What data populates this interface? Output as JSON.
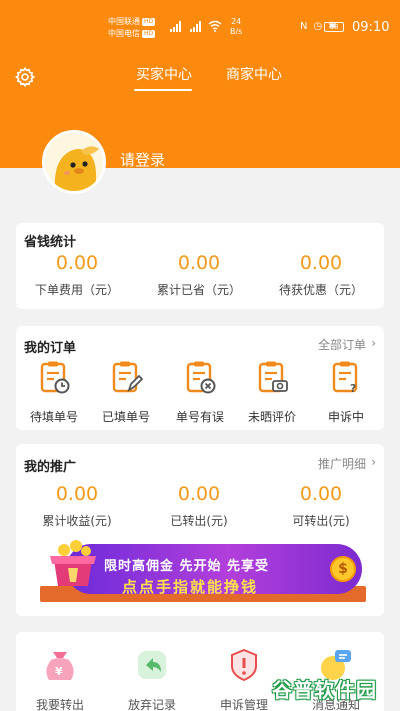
{
  "status_bar": {
    "carrier1": "中国联通",
    "carrier2": "中国电信",
    "badge": "HD",
    "net_speed_value": "24",
    "net_speed_unit": "B/s",
    "battery": "88",
    "time": "09:10"
  },
  "header": {
    "tabs": [
      {
        "label": "买家中心",
        "active": true
      },
      {
        "label": "商家中心",
        "active": false
      }
    ],
    "login_text": "请登录"
  },
  "savings": {
    "title": "省钱统计",
    "stats": [
      {
        "value": "0.00",
        "label": "下单费用（元）"
      },
      {
        "value": "0.00",
        "label": "累计已省（元）"
      },
      {
        "value": "0.00",
        "label": "待获优惠（元）"
      }
    ]
  },
  "orders": {
    "title": "我的订单",
    "link": "全部订单",
    "items": [
      {
        "label": "待填单号",
        "icon": "clock-clipboard-icon"
      },
      {
        "label": "已填单号",
        "icon": "edit-clipboard-icon"
      },
      {
        "label": "单号有误",
        "icon": "error-clipboard-icon"
      },
      {
        "label": "未晒评价",
        "icon": "camera-clipboard-icon"
      },
      {
        "label": "申诉中",
        "icon": "question-clipboard-icon"
      }
    ]
  },
  "promotion": {
    "title": "我的推广",
    "link": "推广明细",
    "stats": [
      {
        "value": "0.00",
        "label": "累计收益(元)"
      },
      {
        "value": "0.00",
        "label": "已转出(元)"
      },
      {
        "value": "0.00",
        "label": "可转出(元)"
      }
    ],
    "banner": {
      "line1": "限时高佣金 先开始 先享受",
      "line2": "点点手指就能挣钱",
      "coin_symbol": "$"
    }
  },
  "bottom_menu": {
    "items": [
      {
        "label": "我要转出",
        "icon": "money-bag-icon"
      },
      {
        "label": "放弃记录",
        "icon": "return-arrow-icon"
      },
      {
        "label": "申诉管理",
        "icon": "warning-shield-icon"
      },
      {
        "label": "消息通知",
        "icon": "chat-bubble-icon"
      }
    ]
  },
  "watermark": "谷普软件园",
  "colors": {
    "brand_orange": "#fb8a0e",
    "value_orange": "#f39a1a",
    "background": "#f2f2f2"
  }
}
